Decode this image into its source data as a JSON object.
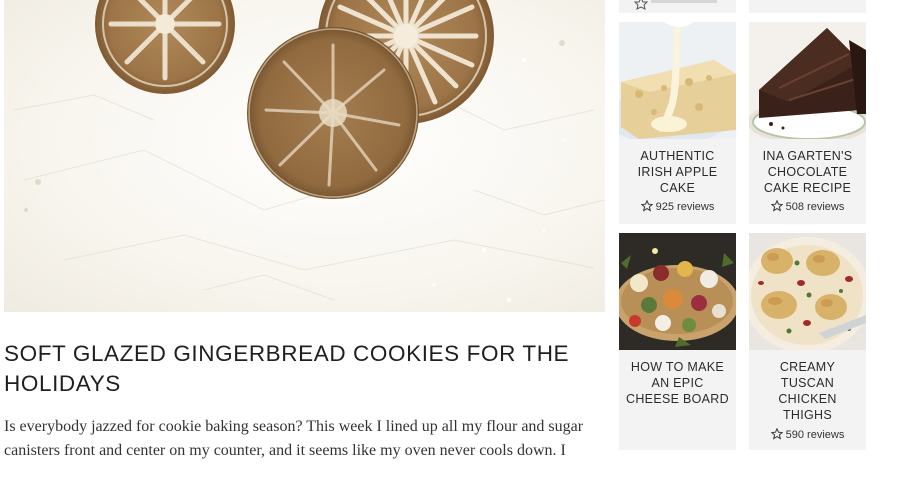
{
  "article": {
    "title": "Soft Glazed Gingerbread Cookies for the Holidays",
    "excerpt": "Is everybody jazzed for cookie baking season? This week I lined up all my flour and sugar canisters front and center on my counter, and it seems like my oven never cools down. I"
  },
  "sidebar": {
    "cards": [
      {
        "title": "Authentic Irish Apple Cake",
        "reviews": "925 reviews"
      },
      {
        "title": "Ina Garten's Chocolate Cake Recipe",
        "reviews": "508 reviews"
      },
      {
        "title": "How to Make an Epic Cheese Board",
        "reviews": ""
      },
      {
        "title": "Creamy Tuscan Chicken Thighs",
        "reviews": "590 reviews"
      }
    ]
  },
  "icons": {
    "star": "star-outline-icon"
  },
  "colors": {
    "card_background": "#f3f3f3",
    "title_text": "#1f1f1f",
    "body_text": "#333333"
  }
}
